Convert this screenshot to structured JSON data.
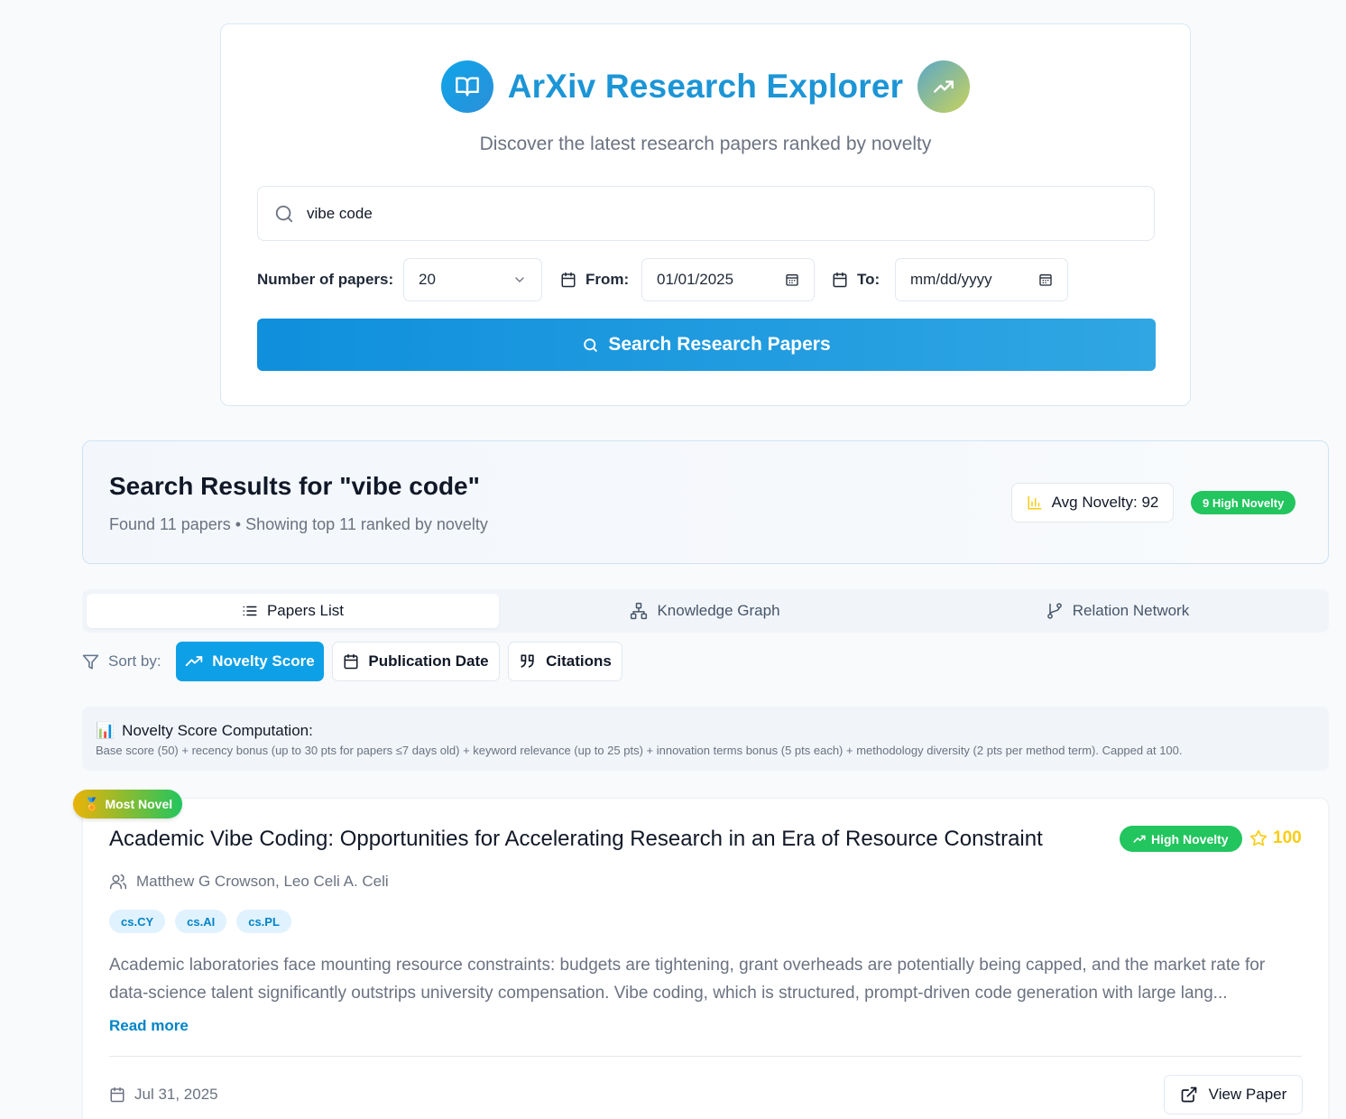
{
  "header": {
    "title": "ArXiv Research Explorer",
    "subtitle": "Discover the latest research papers ranked by novelty"
  },
  "search": {
    "value": "vibe code",
    "button_label": "Search Research Papers"
  },
  "filters": {
    "num_papers_label": "Number of papers:",
    "num_papers_value": "20",
    "from_label": "From:",
    "from_value": "01/01/2025",
    "to_label": "To:",
    "to_placeholder": "mm/dd/yyyy"
  },
  "summary": {
    "title": "Search Results for \"vibe code\"",
    "found": "Found 11 papers • Showing top 11 ranked by novelty",
    "avg_novelty": "Avg Novelty: 92",
    "high_novelty_count": "9 High Novelty"
  },
  "tabs": [
    {
      "label": "Papers List",
      "icon": "list-icon",
      "active": true
    },
    {
      "label": "Knowledge Graph",
      "icon": "graph-icon",
      "active": false
    },
    {
      "label": "Relation Network",
      "icon": "branch-icon",
      "active": false
    }
  ],
  "sort": {
    "label": "Sort by:",
    "options": [
      {
        "label": "Novelty Score",
        "icon": "trending-up-icon",
        "active": true
      },
      {
        "label": "Publication Date",
        "icon": "calendar-icon",
        "active": false
      },
      {
        "label": "Citations",
        "icon": "quote-icon",
        "active": false
      }
    ]
  },
  "note": {
    "icon": "📊",
    "title": "Novelty Score Computation:",
    "description": "Base score (50) + recency bonus (up to 30 pts for papers ≤7 days old) + keyword relevance (up to 25 pts) + innovation terms bonus (5 pts each) + methodology diversity (2 pts per method term). Capped at 100."
  },
  "papers": [
    {
      "ribbon": "Most Novel",
      "ribbon_icon": "🏅",
      "title": "Academic Vibe Coding: Opportunities for Accelerating Research in an Era of Resource Constraint",
      "badge": "High Novelty",
      "score": "100",
      "authors": "Matthew G Crowson, Leo Celi A. Celi",
      "tags": [
        "cs.CY",
        "cs.AI",
        "cs.PL"
      ],
      "abstract": "Academic laboratories face mounting resource constraints: budgets are tightening, grant overheads are potentially being capped, and the market rate for data-science talent significantly outstrips university compensation. Vibe coding, which is structured, prompt-driven code generation with large lang...",
      "read_more": "Read more",
      "date": "Jul 31, 2025",
      "view_label": "View Paper"
    }
  ],
  "colors": {
    "brand": "#1c95d6",
    "primary_button": "#0ea0e6",
    "high_novelty": "#22c55e",
    "score_star": "#facc15",
    "tag_bg": "#e0f2fe",
    "tag_text": "#0284c7"
  }
}
